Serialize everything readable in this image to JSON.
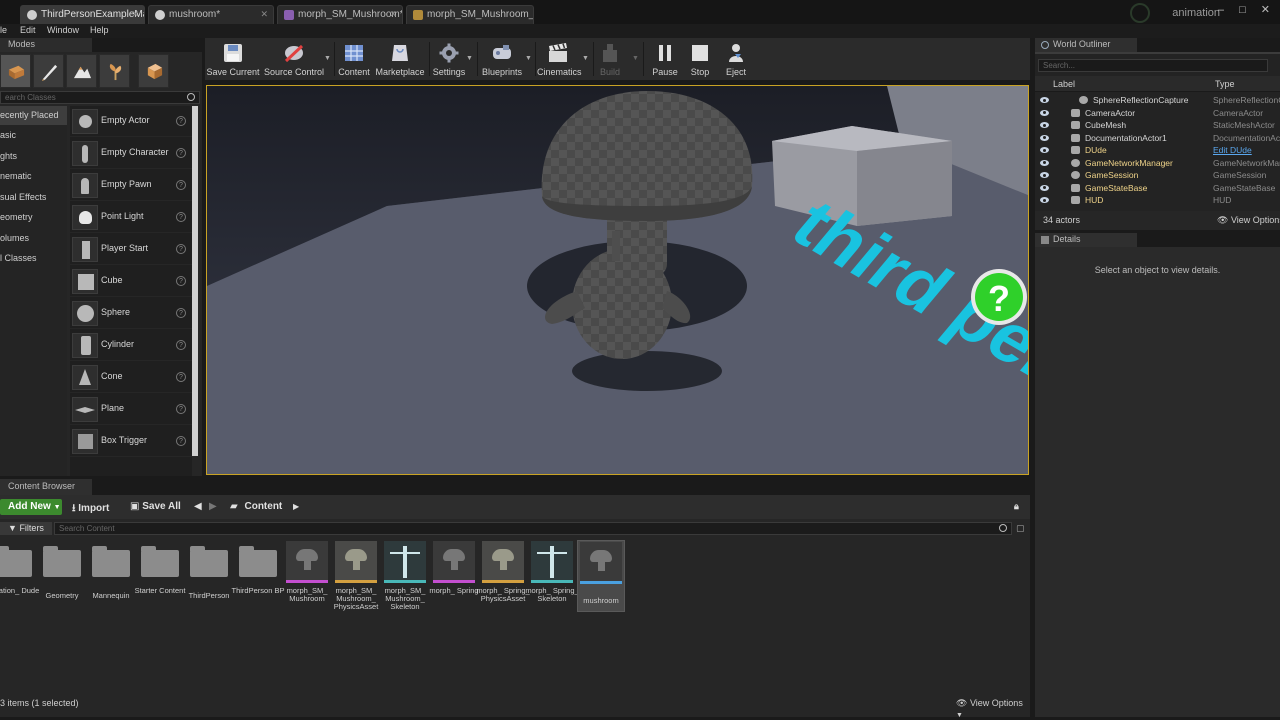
{
  "window": {
    "tabs": [
      {
        "label": "ThirdPersonExampleMap*",
        "icon": "level-icon",
        "active": true
      },
      {
        "label": "mushroom*",
        "icon": "mesh-icon"
      },
      {
        "label": "morph_SM_Mushroom*",
        "icon": "skeletal-mesh-icon"
      },
      {
        "label": "morph_SM_Mushroom_Ph",
        "icon": "physics-asset-icon"
      }
    ],
    "project_name": "animation",
    "controls": "–  □  ✕"
  },
  "menu": {
    "items": [
      "le",
      "Edit",
      "Window",
      "Help"
    ]
  },
  "modes": {
    "tab_label": "Modes",
    "tool_icons": [
      "place-mode-icon",
      "paint-mode-icon",
      "landscape-mode-icon",
      "foliage-mode-icon",
      "geometry-mode-icon"
    ],
    "search_placeholder": "earch Classes",
    "categories": [
      "ecently Placed",
      "asic",
      "ghts",
      "nematic",
      "sual Effects",
      "eometry",
      "olumes",
      "l Classes"
    ],
    "items": [
      {
        "label": "Empty Actor",
        "icon": "sphere-shape"
      },
      {
        "label": "Empty Character",
        "icon": "character-shape"
      },
      {
        "label": "Empty Pawn",
        "icon": "pawn-shape"
      },
      {
        "label": "Point Light",
        "icon": "light-bulb"
      },
      {
        "label": "Player Start",
        "icon": "player-start"
      },
      {
        "label": "Cube",
        "icon": "cube-shape"
      },
      {
        "label": "Sphere",
        "icon": "sphere-shape"
      },
      {
        "label": "Cylinder",
        "icon": "cylinder-shape"
      },
      {
        "label": "Cone",
        "icon": "cone-shape"
      },
      {
        "label": "Plane",
        "icon": "plane-shape"
      },
      {
        "label": "Box Trigger",
        "icon": "box-trigger-shape"
      }
    ]
  },
  "toolbar": {
    "buttons": [
      {
        "label": "Save Current",
        "icon": "save-icon"
      },
      {
        "label": "Source Control",
        "icon": "source-control-icon",
        "has_menu": true
      },
      {
        "label": "Content",
        "icon": "content-icon"
      },
      {
        "label": "Marketplace",
        "icon": "marketplace-icon"
      },
      {
        "label": "Settings",
        "icon": "settings-icon",
        "has_menu": true
      },
      {
        "label": "Blueprints",
        "icon": "blueprints-icon",
        "has_menu": true
      },
      {
        "label": "Cinematics",
        "icon": "cinematics-icon",
        "has_menu": true
      },
      {
        "label": "Build",
        "icon": "build-icon",
        "has_menu": true,
        "disabled": true
      },
      {
        "label": "Pause",
        "icon": "pause-icon"
      },
      {
        "label": "Stop",
        "icon": "stop-icon"
      },
      {
        "label": "Eject",
        "icon": "eject-icon"
      }
    ]
  },
  "viewport": {
    "floor_text": "third per"
  },
  "outliner": {
    "tab_label": "World Outliner",
    "search_placeholder": "Search...",
    "col_label": "Label",
    "col_type": "Type",
    "rows": [
      {
        "label": "SphereReflectionCapture",
        "type": "SphereReflectionC"
      },
      {
        "label": "CameraActor",
        "type": "CameraActor"
      },
      {
        "label": "CubeMesh",
        "type": "StaticMeshActor"
      },
      {
        "label": "DocumentationActor1",
        "type": "DocumentationAct"
      },
      {
        "label": "DUde",
        "type": "Edit DUde",
        "type_is_link": true
      },
      {
        "label": "GameNetworkManager",
        "type": "GameNetworkMar"
      },
      {
        "label": "GameSession",
        "type": "GameSession"
      },
      {
        "label": "GameStateBase",
        "type": "GameStateBase"
      },
      {
        "label": "HUD",
        "type": "HUD"
      }
    ],
    "count": "34 actors",
    "view_options": "View Options"
  },
  "details": {
    "tab_label": "Details",
    "message": "Select an object to view details."
  },
  "content_browser": {
    "tab_label": "Content Browser",
    "add_new": "Add New",
    "import": "Import",
    "save_all": "Save All",
    "path": "Content",
    "filters": "Filters",
    "search_placeholder": "Search Content",
    "assets": [
      {
        "label": "nimation_ Dude",
        "kind": "folder"
      },
      {
        "label": "Geometry",
        "kind": "folder"
      },
      {
        "label": "Mannequin",
        "kind": "folder"
      },
      {
        "label": "Starter Content",
        "kind": "folder"
      },
      {
        "label": "ThirdPerson",
        "kind": "folder"
      },
      {
        "label": "ThirdPerson BP",
        "kind": "folder"
      },
      {
        "label": "morph_SM_ Mushroom",
        "kind": "skeletal-mesh"
      },
      {
        "label": "morph_SM_ Mushroom_ PhysicsAsset",
        "kind": "physics-asset"
      },
      {
        "label": "morph_SM_ Mushroom_ Skeleton",
        "kind": "skeleton"
      },
      {
        "label": "morph_ Spring",
        "kind": "skeletal-mesh"
      },
      {
        "label": "morph_ Spring_ PhysicsAsset",
        "kind": "physics-asset"
      },
      {
        "label": "morph_ Spring_ Skeleton",
        "kind": "skeleton"
      },
      {
        "label": "mushroom",
        "kind": "static-mesh",
        "selected": true
      }
    ],
    "status": "3 items (1 selected)",
    "view_options": "View Options"
  },
  "colors": {
    "accent_gold": "#c9a324",
    "add_new_green": "#3c8a2e",
    "cyan_text": "#19c3e0",
    "skeletal_mesh_bar": "#c44fd0",
    "physics_asset_bar": "#d4a040",
    "skeleton_bar": "#49b8b8",
    "static_mesh_bar": "#4aa0e0",
    "help_icon_green": "#2fd02a"
  }
}
